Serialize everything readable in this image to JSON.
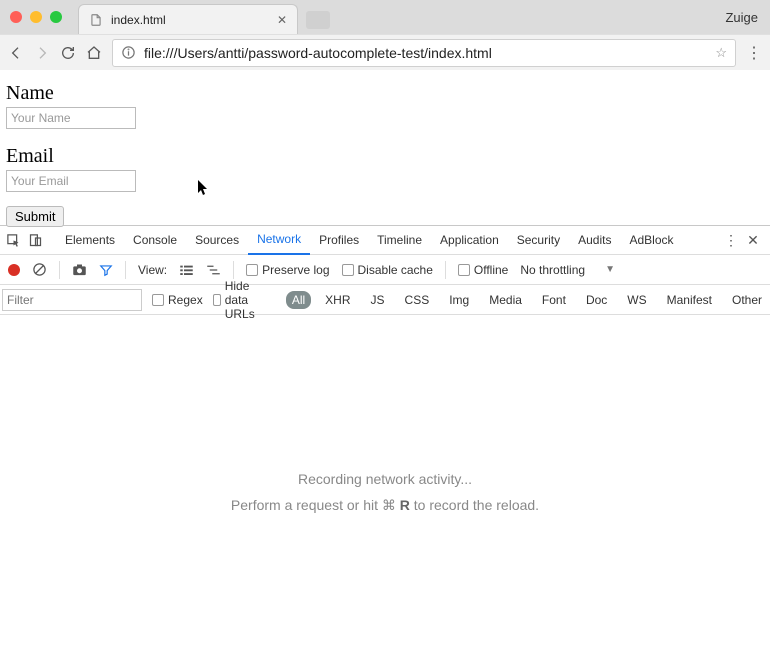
{
  "browser": {
    "profile_name": "Zuige",
    "tab": {
      "title": "index.html"
    },
    "url": "file:///Users/antti/password-autocomplete-test/index.html"
  },
  "page": {
    "name_label": "Name",
    "name_placeholder": "Your Name",
    "email_label": "Email",
    "email_placeholder": "Your Email",
    "submit_label": "Submit"
  },
  "devtools": {
    "tabs": [
      "Elements",
      "Console",
      "Sources",
      "Network",
      "Profiles",
      "Timeline",
      "Application",
      "Security",
      "Audits",
      "AdBlock"
    ],
    "active_tab": "Network",
    "toolbar": {
      "view_label": "View:",
      "preserve_log": "Preserve log",
      "disable_cache": "Disable cache",
      "offline": "Offline",
      "throttling": "No throttling"
    },
    "filter": {
      "placeholder": "Filter",
      "regex": "Regex",
      "hide_data_urls": "Hide data URLs",
      "types": [
        "All",
        "XHR",
        "JS",
        "CSS",
        "Img",
        "Media",
        "Font",
        "Doc",
        "WS",
        "Manifest",
        "Other"
      ],
      "active_type": "All"
    },
    "empty": {
      "line1": "Recording network activity...",
      "line2_a": "Perform a request or hit ",
      "line2_b": " R",
      "line2_c": " to record the reload."
    }
  }
}
